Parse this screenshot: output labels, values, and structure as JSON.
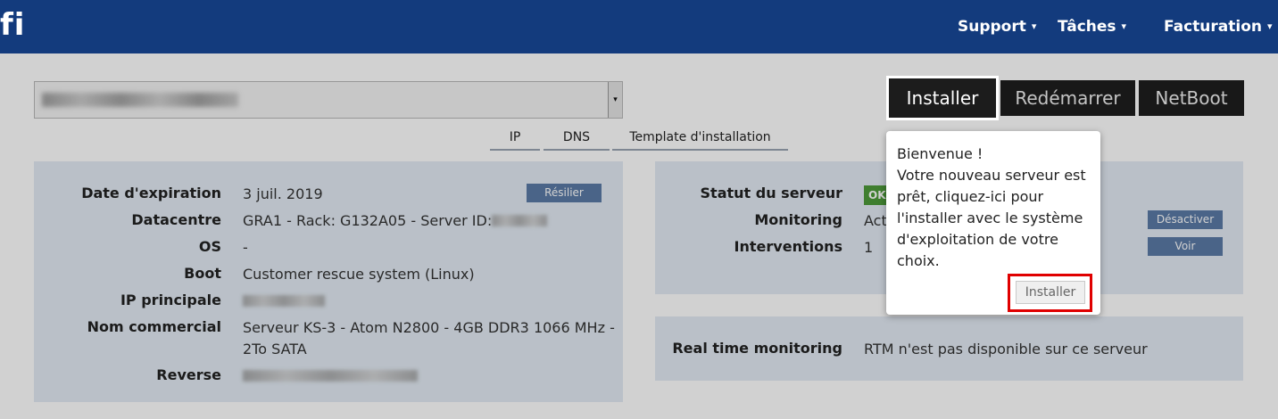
{
  "header": {
    "logo_text": "fi",
    "nav": [
      {
        "label": "Support",
        "caret": "▾"
      },
      {
        "label": "Tâches",
        "caret": "▾"
      },
      {
        "label": "Facturation",
        "caret": "▾"
      }
    ]
  },
  "server_select": {
    "arrow": "▾"
  },
  "tabs": [
    "IP",
    "DNS",
    "Template d'installation"
  ],
  "actions": {
    "install": "Installer",
    "reboot": "Redémarrer",
    "netboot": "NetBoot"
  },
  "info": {
    "expiration_label": "Date d'expiration",
    "expiration_value": "3 juil. 2019",
    "resilier_button": "Résilier",
    "datacentre_label": "Datacentre",
    "datacentre_value": "GRA1 - Rack: G132A05 - Server ID:",
    "os_label": "OS",
    "os_value": "-",
    "boot_label": "Boot",
    "boot_value": "Customer rescue system (Linux)",
    "ip_label": "IP principale",
    "commercial_label": "Nom commercial",
    "commercial_value_line1": "Serveur KS-3 - Atom N2800 - 4GB DDR3 1066 MHz -",
    "commercial_value_line2": "2To SATA",
    "reverse_label": "Reverse"
  },
  "status": {
    "statut_label": "Statut du serveur",
    "statut_value": "OK",
    "monitoring_label": "Monitoring",
    "monitoring_value": "Act",
    "desactiver_button": "Désactiver",
    "interventions_label": "Interventions",
    "interventions_value": "1",
    "voir_button": "Voir"
  },
  "rtm": {
    "label": "Real time monitoring",
    "value": "RTM n'est pas disponible sur ce serveur"
  },
  "popover": {
    "text": "Bienvenue !\nVotre nouveau serveur est prêt, cliquez-ici pour l'installer avec le système d'exploitation de votre choix.",
    "button": "Installer"
  }
}
